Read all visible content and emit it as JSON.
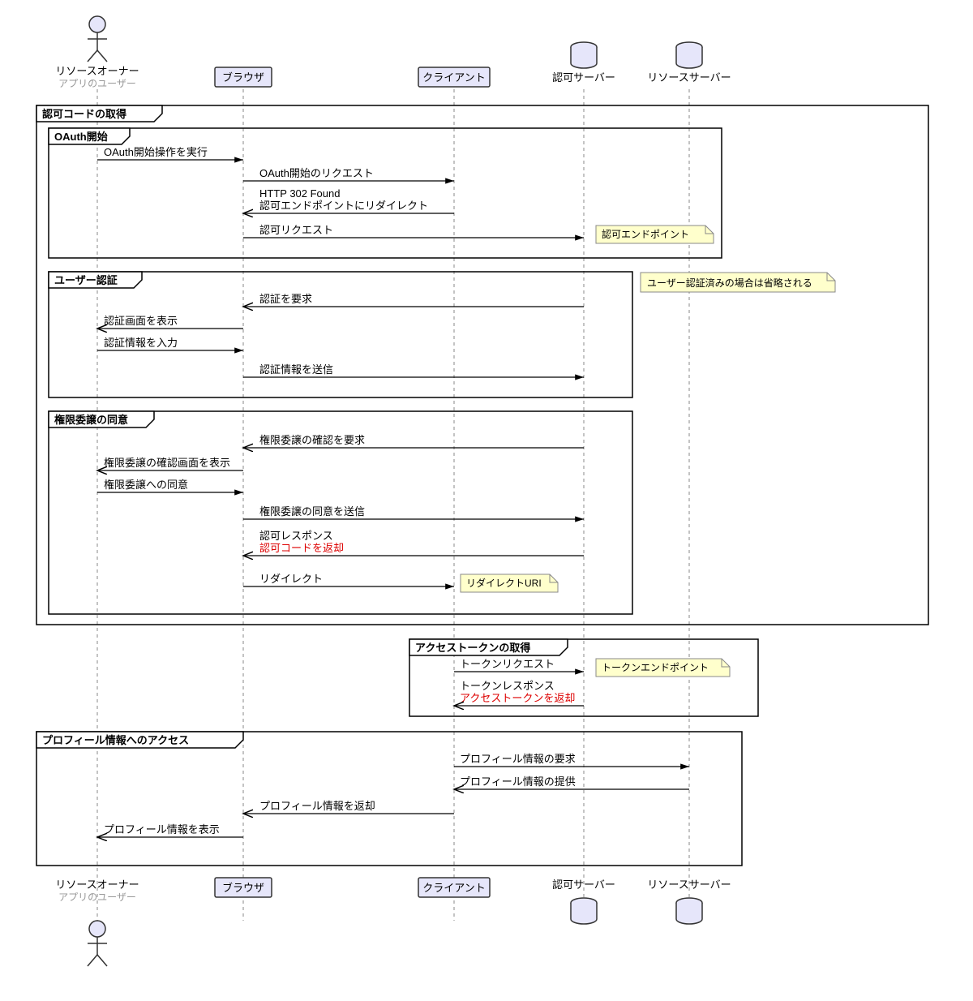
{
  "actors": {
    "owner": {
      "name": "リソースオーナー",
      "sub": "アプリのユーザー"
    },
    "browser": {
      "name": "ブラウザ"
    },
    "client": {
      "name": "クライアント"
    },
    "authsrv": {
      "name": "認可サーバー"
    },
    "ressrv": {
      "name": "リソースサーバー"
    }
  },
  "frames": {
    "f1": "認可コードの取得",
    "f1a": "OAuth開始",
    "f1b": "ユーザー認証",
    "f1c": "権限委譲の同意",
    "f2": "アクセストークンの取得",
    "f3": "プロフィール情報へのアクセス"
  },
  "notes": {
    "n1": "認可エンドポイント",
    "n2": "ユーザー認証済みの場合は省略される",
    "n3": "リダイレクトURI",
    "n4": "トークンエンドポイント"
  },
  "messages": {
    "m1": "OAuth開始操作を実行",
    "m2": "OAuth開始のリクエスト",
    "m3a": "HTTP 302 Found",
    "m3b": "認可エンドポイントにリダイレクト",
    "m4": "認可リクエスト",
    "m5": "認証を要求",
    "m6": "認証画面を表示",
    "m7": "認証情報を入力",
    "m8": "認証情報を送信",
    "m9": "権限委譲の確認を要求",
    "m10": "権限委譲の確認画面を表示",
    "m11": "権限委譲への同意",
    "m12": "権限委譲の同意を送信",
    "m13a": "認可レスポンス",
    "m13b": "認可コードを返却",
    "m14": "リダイレクト",
    "m15": "トークンリクエスト",
    "m16a": "トークンレスポンス",
    "m16b": "アクセストークンを返却",
    "m17": "プロフィール情報の要求",
    "m18": "プロフィール情報の提供",
    "m19": "プロフィール情報を返却",
    "m20": "プロフィール情報を表示"
  }
}
